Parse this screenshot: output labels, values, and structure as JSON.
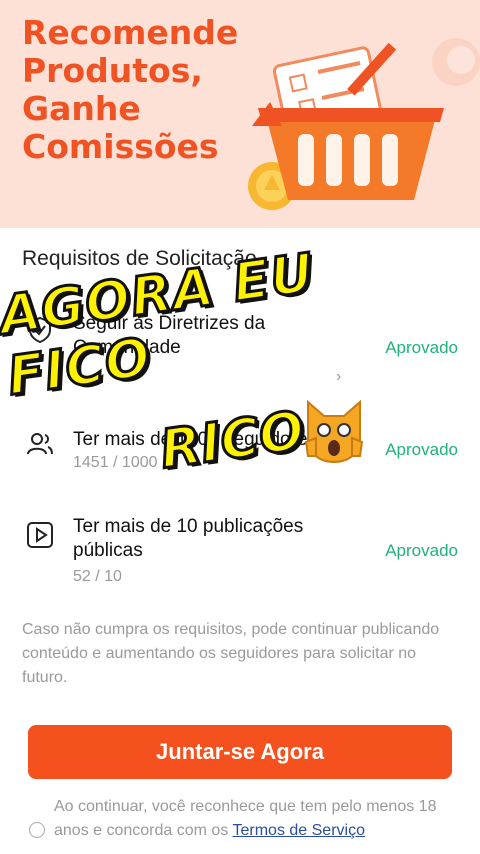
{
  "hero": {
    "title": "Recomende Produtos, Ganhe Comissões"
  },
  "requirements": {
    "title": "Requisitos de Solicitação",
    "items": [
      {
        "text": "Seguir as Diretrizes da Comunidade",
        "count": "",
        "status": "Aprovado",
        "icon": "shield-check-icon"
      },
      {
        "text": "Ter mais de 1000 seguidores",
        "count": "1451 / 1000",
        "status": "Aprovado",
        "icon": "followers-icon"
      },
      {
        "text": "Ter mais de 10 publicações públicas",
        "count": "52 / 10",
        "status": "Aprovado",
        "icon": "video-play-icon"
      }
    ]
  },
  "note": "Caso não cumpra os requisitos, pode continuar publicando conteúdo e aumentando os seguidores para solicitar no futuro.",
  "join_button": "Juntar-se Agora",
  "terms": {
    "text": "Ao continuar, você reconhece que tem pelo menos 18 anos e concorda com os ",
    "link": "Termos de Serviço"
  },
  "overlay": {
    "line1": "AGORA EU FICO",
    "line2": "RICO",
    "emoji": "😱"
  },
  "colors": {
    "accent": "#f4511e",
    "approved": "#1fb27a",
    "hero_bg": "#fde0d6"
  }
}
